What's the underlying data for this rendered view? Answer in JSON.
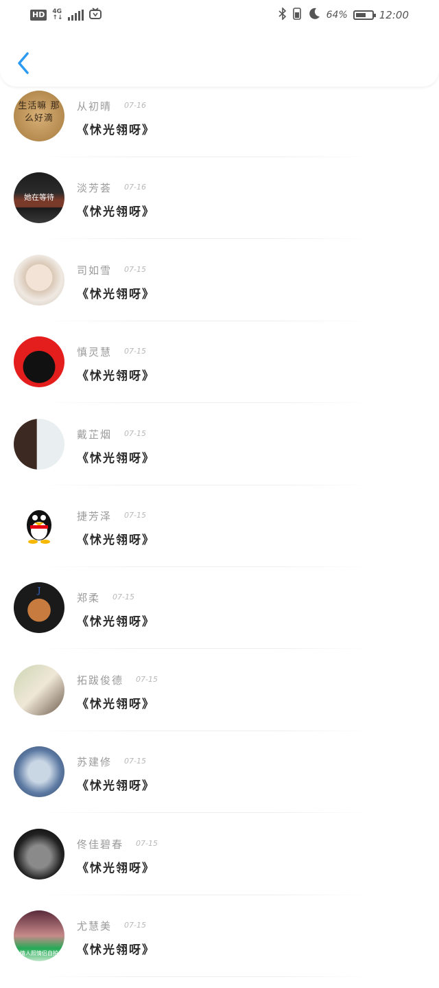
{
  "status_bar": {
    "hd": "HD",
    "network": "4G",
    "battery_percent_text": "64%",
    "battery_level": 0.64,
    "time": "12:00",
    "icons": [
      "signal-icon",
      "tv-icon",
      "bluetooth-icon",
      "vibrate-icon",
      "moon-icon",
      "battery-icon"
    ]
  },
  "header": {
    "back_icon": "back-chevron-icon",
    "accent": "#2b9af3"
  },
  "list": [
    {
      "name": "从初晴",
      "date": "07-16",
      "snippet": "《怵光翎呀》",
      "avatar_text": "生活嘛 那么好滴"
    },
    {
      "name": "淡芳荟",
      "date": "07-16",
      "snippet": "《怵光翎呀》",
      "avatar_text": "她在等待"
    },
    {
      "name": "司如雪",
      "date": "07-15",
      "snippet": "《怵光翎呀》",
      "avatar_text": ""
    },
    {
      "name": "慎灵慧",
      "date": "07-15",
      "snippet": "《怵光翎呀》",
      "avatar_text": ""
    },
    {
      "name": "戴芷烟",
      "date": "07-15",
      "snippet": "《怵光翎呀》",
      "avatar_text": ""
    },
    {
      "name": "捷芳泽",
      "date": "07-15",
      "snippet": "《怵光翎呀》",
      "avatar_text": ""
    },
    {
      "name": "郑柔",
      "date": "07-15",
      "snippet": "《怵光翎呀》",
      "avatar_text": "J"
    },
    {
      "name": "拓跋俊德",
      "date": "07-15",
      "snippet": "《怵光翎呀》",
      "avatar_text": ""
    },
    {
      "name": "苏建修",
      "date": "07-15",
      "snippet": "《怵光翎呀》",
      "avatar_text": ""
    },
    {
      "name": "佟佳碧春",
      "date": "07-15",
      "snippet": "《怵光翎呀》",
      "avatar_text": ""
    },
    {
      "name": "尤慧美",
      "date": "07-15",
      "snippet": "《怵光翎呀》",
      "avatar_text": "情人照情侣自拍"
    }
  ]
}
